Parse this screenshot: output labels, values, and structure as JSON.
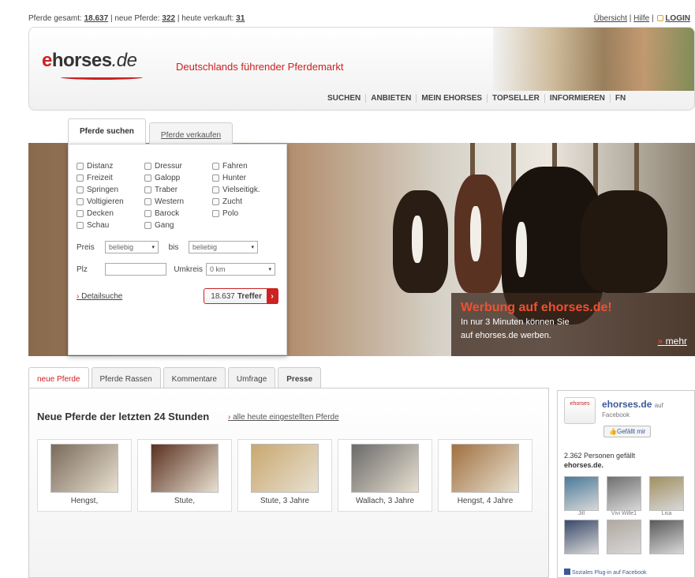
{
  "stats": {
    "total_label": "Pferde gesamt:",
    "total_value": "18.637",
    "new_label": "neue Pferde:",
    "new_value": "322",
    "sold_label": "heute verkauft:",
    "sold_value": "31"
  },
  "toplinks": {
    "overview": "Übersicht",
    "help": "Hilfe",
    "login": "LOGIN"
  },
  "brand": {
    "logo_e": "e",
    "logo_horses": "horses",
    "logo_de": ".de",
    "slogan": "Deutschlands führender Pferdemarkt",
    "accent_color": "#cc2222"
  },
  "nav": [
    "SUCHEN",
    "ANBIETEN",
    "MEIN EHORSES",
    "TOPSELLER",
    "INFORMIEREN",
    "FN"
  ],
  "search": {
    "tab_active": "Pferde suchen",
    "tab_inactive": "Pferde verkaufen",
    "disciplines": [
      "Distanz",
      "Dressur",
      "Fahren",
      "Freizeit",
      "Galopp",
      "Hunter",
      "Springen",
      "Traber",
      "Vielseitigk.",
      "Voltigieren",
      "Western",
      "Zucht",
      "Decken",
      "Barock",
      "Polo",
      "Schau",
      "Gang"
    ],
    "price_label": "Preis",
    "price_from": "beliebig",
    "price_to_label": "bis",
    "price_to": "beliebig",
    "plz_label": "Plz",
    "plz_value": "",
    "radius_label": "Umkreis",
    "radius_value": "0 km",
    "detail_link": "Detailsuche",
    "hits_count": "18.637",
    "hits_label": "Treffer"
  },
  "promo": {
    "title": "Werbung auf ehorses.de!",
    "line1": "In nur 3 Minuten können Sie",
    "line2": "auf ehorses.de werben.",
    "more": "mehr"
  },
  "bottom_tabs": [
    "neue Pferde",
    "Pferde Rassen",
    "Kommentare",
    "Umfrage",
    "Presse"
  ],
  "new_horses": {
    "title": "Neue Pferde der letzten 24 Stunden",
    "link": "alle heute eingestellten Pferde",
    "items": [
      {
        "caption": "Hengst,",
        "color": "#7a6a5a"
      },
      {
        "caption": "Stute,",
        "color": "#5a3020"
      },
      {
        "caption": "Stute, 3 Jahre",
        "color": "#c8a870"
      },
      {
        "caption": "Wallach, 3 Jahre",
        "color": "#6a6a6a"
      },
      {
        "caption": "Hengst, 4 Jahre",
        "color": "#a07040"
      }
    ]
  },
  "facebook": {
    "page_name": "ehorses.de",
    "on": "auf",
    "sub": "Facebook",
    "like_button": "Gefällt mir",
    "count_text": "2.362 Personen gefällt",
    "count_text2": "ehorses.de.",
    "faces": [
      {
        "name": "Jill",
        "color": "#4a7a9a"
      },
      {
        "name": "Vivi Wille1",
        "color": "#707070"
      },
      {
        "name": "Lisa",
        "color": "#a09060"
      },
      {
        "name": "",
        "color": "#3a4a6a"
      },
      {
        "name": "",
        "color": "#b0a8a0"
      },
      {
        "name": "",
        "color": "#5a5a5a"
      }
    ],
    "footer": "Soziales Plug-in auf Facebook"
  }
}
